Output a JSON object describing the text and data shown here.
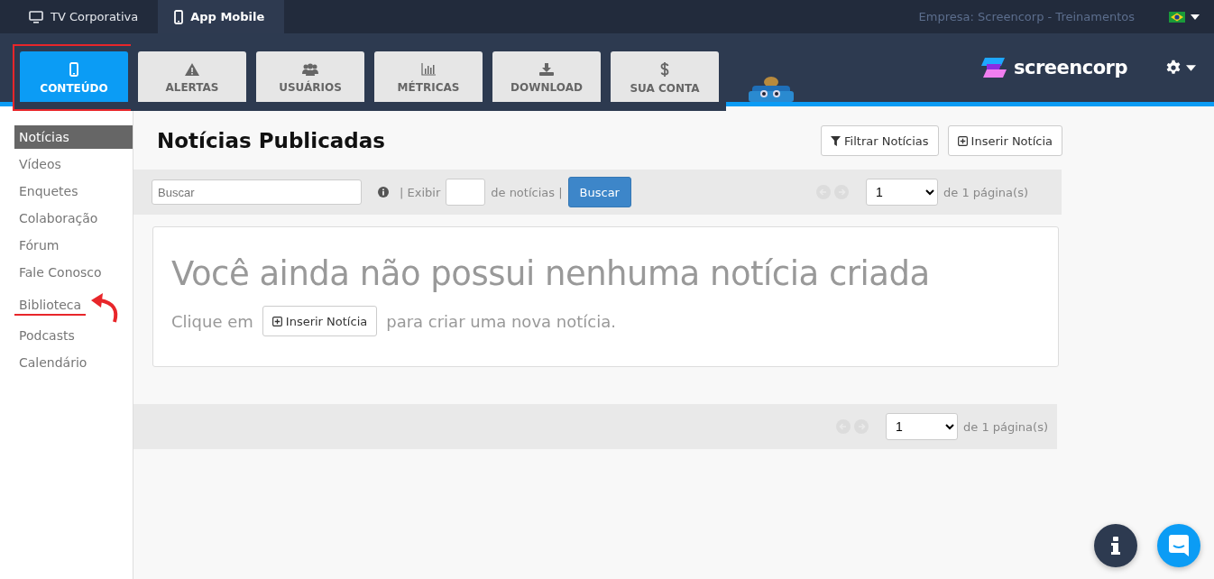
{
  "top_tabs": [
    {
      "label": "TV Corporativa",
      "kind": "monitor",
      "selected": false
    },
    {
      "label": "App Mobile",
      "kind": "phone",
      "selected": true
    }
  ],
  "company": "Empresa: Screencorp - Treinamentos",
  "logo": "screencorp",
  "nav_tabs": [
    {
      "label": "CONTEÚDO",
      "kind": "phone",
      "selected": true,
      "highlighted": true
    },
    {
      "label": "ALERTAS",
      "kind": "warning",
      "selected": false,
      "highlighted": false
    },
    {
      "label": "USUÁRIOS",
      "kind": "users",
      "selected": false,
      "highlighted": false
    },
    {
      "label": "MÉTRICAS",
      "kind": "chart",
      "selected": false,
      "highlighted": false
    },
    {
      "label": "DOWNLOAD",
      "kind": "download",
      "selected": false,
      "highlighted": false
    },
    {
      "label": "SUA CONTA",
      "kind": "dollar",
      "selected": false,
      "highlighted": false
    }
  ],
  "sidebar": {
    "items": [
      {
        "label": "Notícias",
        "selected": true,
        "annotated": false
      },
      {
        "label": "Vídeos",
        "selected": false,
        "annotated": false
      },
      {
        "label": "Enquetes",
        "selected": false,
        "annotated": false
      },
      {
        "label": "Colaboração",
        "selected": false,
        "annotated": false
      },
      {
        "label": "Fórum",
        "selected": false,
        "annotated": false
      },
      {
        "label": "Fale Conosco",
        "selected": false,
        "annotated": false
      },
      {
        "label": "Biblioteca",
        "selected": false,
        "annotated": true
      },
      {
        "label": "Podcasts",
        "selected": false,
        "annotated": false
      },
      {
        "label": "Calendário",
        "selected": false,
        "annotated": false
      }
    ]
  },
  "page": {
    "title": "Notícias Publicadas",
    "buttons": [
      {
        "label": "Filtrar Notícias",
        "kind": "filter"
      },
      {
        "label": "Inserir Notícia",
        "kind": "plus"
      }
    ]
  },
  "toolbar": {
    "search_placeholder": "Buscar",
    "show_label": "| Exibir",
    "count_suffix": "de notícias |",
    "search_button": "Buscar",
    "page": "1",
    "pages_label": "de 1 página(s)"
  },
  "empty": {
    "heading": "Você ainda não possui nenhuma notícia criada",
    "before": "Clique em",
    "button": "Inserir Notícia",
    "after": "para criar uma nova notícia."
  },
  "bottom_pager": {
    "page": "1",
    "pages_label": "de 1 página(s)"
  }
}
